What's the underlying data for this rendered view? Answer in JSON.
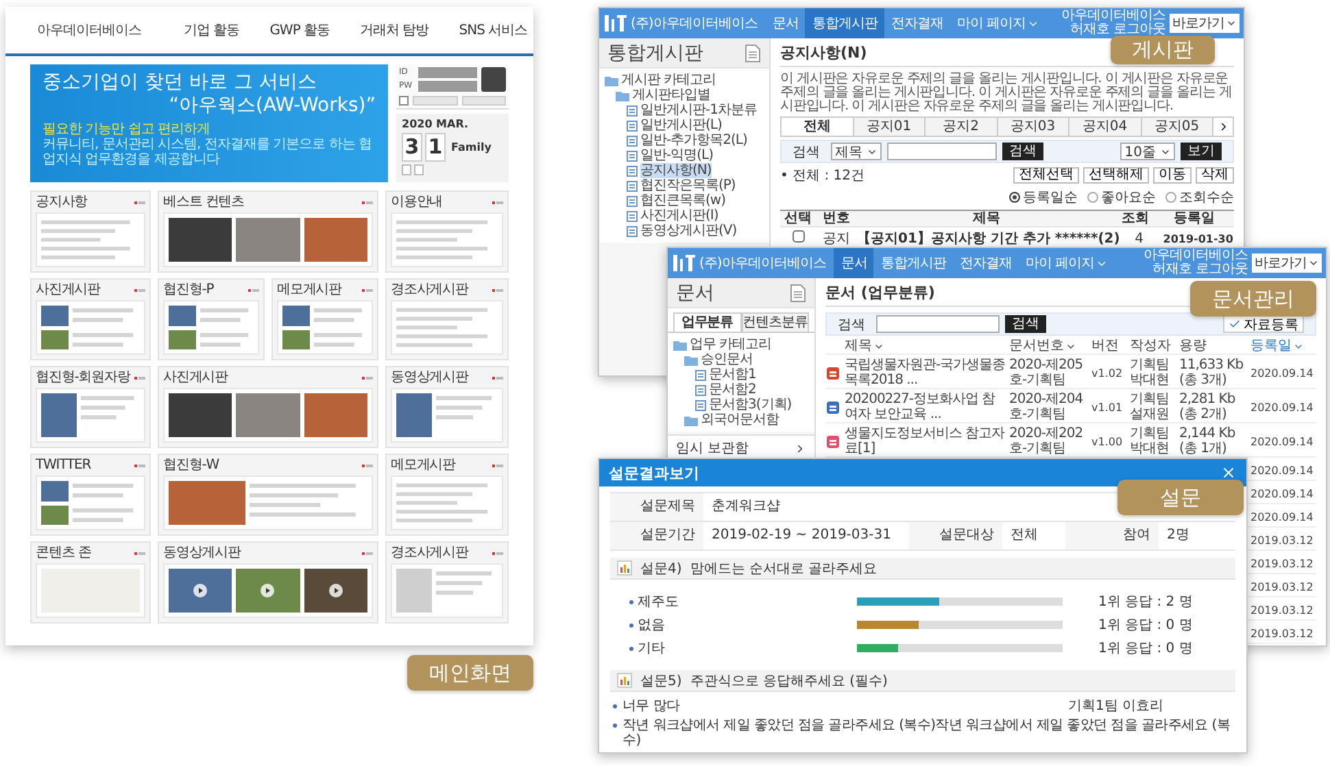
{
  "main_page": {
    "logo": "아우데이터베이스",
    "nav": [
      "기업 활동",
      "GWP 활동",
      "거래처 탐방",
      "SNS 서비스"
    ],
    "banner": {
      "title": "중소기업이 찾던 바로 그 서비스",
      "subtitle": "“아우웍스(AW-Works)”",
      "tagline": "필요한 기능만 쉽고 편리하게",
      "description": "커뮤니티, 문서관리 시스템, 전자결재를 기본으로 하는 협업지식 업무환경을 제공합니다"
    },
    "login": {
      "id_label": "ID",
      "pw_label": "PW",
      "remember_checked": false
    },
    "calendar": {
      "month": "2020 MAR.",
      "digits": [
        "3",
        "1"
      ],
      "label": "Family"
    },
    "panel_rows": [
      [
        {
          "title": "공지사항",
          "kind": "list"
        },
        {
          "title": "베스트 컨텐츠",
          "kind": "photos"
        },
        {
          "title": "이용안내",
          "kind": "list"
        }
      ],
      [
        {
          "title": "사진게시판",
          "kind": "thumbs"
        },
        {
          "title": "협진형-P",
          "kind": "thumbs"
        },
        {
          "title": "메모게시판",
          "kind": "thumbs"
        },
        {
          "title": "경조사게시판",
          "kind": "list"
        }
      ],
      [
        {
          "title": "협진형-회원자랑",
          "kind": "thumb"
        },
        {
          "title": "사진게시판",
          "kind": "photos"
        },
        {
          "title": "동영상게시판",
          "kind": "thumb"
        }
      ],
      [
        {
          "title": "TWITTER",
          "kind": "thumbs"
        },
        {
          "title": "협진형-W",
          "kind": "feature"
        },
        {
          "title": "메모게시판",
          "kind": "list"
        }
      ],
      [
        {
          "title": "콘텐츠 존",
          "kind": "promo"
        },
        {
          "title": "동영상게시판",
          "kind": "videos"
        },
        {
          "title": "경조사게시판",
          "kind": "profile"
        }
      ]
    ],
    "badge": "메인화면"
  },
  "board_window": {
    "header": {
      "logo": "(주)아우데이터베이스",
      "nav": [
        {
          "label": "문서",
          "selected": false,
          "has_menu": false
        },
        {
          "label": "통합게시판",
          "selected": true,
          "has_menu": false
        },
        {
          "label": "전자결재",
          "selected": false,
          "has_menu": false
        },
        {
          "label": "마이 페이지",
          "selected": false,
          "has_menu": true
        }
      ],
      "company": "아우데이터베이스",
      "user": "허재호",
      "logout": "로그아웃",
      "quick_select": "바로가기"
    },
    "sidebar_title": "통합게시판",
    "tree": [
      {
        "label": "게시판 카테고리",
        "kind": "folder",
        "selected": false,
        "children": [
          {
            "label": "게시판타입별",
            "kind": "folder",
            "selected": false,
            "children": [
              {
                "label": "일반게시판-1차분류",
                "kind": "page",
                "selected": false
              },
              {
                "label": "일반게시판(L)",
                "kind": "page",
                "selected": false
              },
              {
                "label": "일반-추가항목2(L)",
                "kind": "page",
                "selected": false
              },
              {
                "label": "일반-익명(L)",
                "kind": "page",
                "selected": false
              },
              {
                "label": "공지사항(N)",
                "kind": "page",
                "selected": true
              },
              {
                "label": "협진작은목록(P)",
                "kind": "page",
                "selected": false
              },
              {
                "label": "협진큰목록(w)",
                "kind": "page",
                "selected": false
              },
              {
                "label": "사진게시판(I)",
                "kind": "page",
                "selected": false
              },
              {
                "label": "동영상게시판(V)",
                "kind": "page",
                "selected": false
              }
            ]
          }
        ]
      }
    ],
    "board_title": "공지사항(N)",
    "description": "이 게시판은 자유로운 주제의 글을 올리는 게시판입니다. 이 게시판은 자유로운 주제의 글을 올리는 게시판입니다. 이 게시판은 자유로운 주제의 글을 올리는 게시판입니다. 이 게시판은 자유로운 주제의 글을 올리는 게시판입니다.",
    "tabs": [
      {
        "label": "전체",
        "selected": true
      },
      {
        "label": "공지01",
        "selected": false
      },
      {
        "label": "공지2",
        "selected": false
      },
      {
        "label": "공지03",
        "selected": false
      },
      {
        "label": "공지04",
        "selected": false
      },
      {
        "label": "공지05",
        "selected": false
      }
    ],
    "search": {
      "label": "검색",
      "field_select": "제목",
      "button": "검색",
      "rows_select": "10줄",
      "view_button": "보기"
    },
    "total": "• 전체 : 12건",
    "actions": [
      "전체선택",
      "선택해제",
      "이동",
      "삭제"
    ],
    "sort_options": [
      {
        "label": "등록일순",
        "selected": true
      },
      {
        "label": "좋아요순",
        "selected": false
      },
      {
        "label": "조회수순",
        "selected": false
      }
    ],
    "columns": [
      "선택",
      "번호",
      "제목",
      "조회",
      "등록일"
    ],
    "rows": [
      {
        "checked": false,
        "number": "공지",
        "title": "【공지01】공지사항 기간 추가 ******(2)",
        "views": "4",
        "date": "2019-01-30"
      }
    ],
    "badge": "게시판"
  },
  "document_window": {
    "header": {
      "logo": "(주)아우데이터베이스",
      "nav": [
        {
          "label": "문서",
          "selected": true,
          "has_menu": false
        },
        {
          "label": "통합게시판",
          "selected": false,
          "has_menu": false
        },
        {
          "label": "전자결재",
          "selected": false,
          "has_menu": false
        },
        {
          "label": "마이 페이지",
          "selected": false,
          "has_menu": true
        }
      ],
      "company": "아우데이터베이스",
      "user": "허재호",
      "logout": "로그아웃",
      "quick_select": "바로가기"
    },
    "sidebar_title": "문서",
    "tabs": [
      {
        "label": "업무분류",
        "selected": true
      },
      {
        "label": "컨텐츠분류",
        "selected": false
      }
    ],
    "tree": [
      {
        "label": "업무 카테고리",
        "kind": "folder",
        "selected": false,
        "children": [
          {
            "label": "승인문서",
            "kind": "folder",
            "selected": false,
            "children": [
              {
                "label": "문서함1",
                "kind": "page",
                "selected": false
              },
              {
                "label": "문서함2",
                "kind": "page",
                "selected": false
              },
              {
                "label": "문서함3(기획)",
                "kind": "page",
                "selected": false
              }
            ]
          },
          {
            "label": "외국어문서함",
            "kind": "folder",
            "selected": false
          }
        ]
      }
    ],
    "temp_box": "임시 보관함",
    "title": "문서 (업무분류)",
    "search": {
      "label": "검색",
      "button": "검색"
    },
    "register_button": "자료등록",
    "columns": [
      {
        "label": "제목",
        "sort_icon": true,
        "selected": false
      },
      {
        "label": "문서번호",
        "sort_icon": true,
        "selected": false
      },
      {
        "label": "버전",
        "sort_icon": false,
        "selected": false
      },
      {
        "label": "작성자",
        "sort_icon": false,
        "selected": false
      },
      {
        "label": "용량",
        "sort_icon": false,
        "selected": false
      },
      {
        "label": "등록일",
        "sort_icon": true,
        "selected": true
      }
    ],
    "rows": [
      {
        "color": "#d9452f",
        "title": "국립생물자원관-국가생물종목록2018 ...",
        "number": "2020-제205호-기획팀",
        "version": "v1.02",
        "author": "기획팀 박대현",
        "size": "11,633 Kb (총 3개)",
        "date": "2020.09.14"
      },
      {
        "color": "#3a6fc4",
        "title": "20200227-정보화사업 참여자 보안교육 ...",
        "number": "2020-제204호-기획팀",
        "version": "v1.01",
        "author": "기획팀 설재원",
        "size": "2,281 Kb (총 2개)",
        "date": "2020.09.14"
      },
      {
        "color": "#e0506a",
        "title": "생물지도정보서비스 참고자료[1]",
        "number": "2020-제202호-기획팀",
        "version": "v1.00",
        "author": "기획팀 박대현",
        "size": "2,144 Kb (총 1개)",
        "date": "2020.09.14"
      },
      {
        "date": "2020.09.14"
      },
      {
        "date": "2020.09.14"
      },
      {
        "date": "2020.09.14"
      },
      {
        "date": "2019.03.12"
      },
      {
        "date": "2019.03.12"
      },
      {
        "date": "2019.03.12"
      },
      {
        "date": "2019.03.12"
      },
      {
        "date": "2019.03.12"
      }
    ],
    "badge": "문서관리"
  },
  "survey_popup": {
    "title": "설문결과보기",
    "info": {
      "title_label": "설문제목",
      "title_value": "춘계워크샵",
      "period_label": "설문기간",
      "period_value": "2019-02-19 ~ 2019-03-31",
      "target_label": "설문대상",
      "target_value": "전체",
      "participants_label": "참여",
      "participants_value": "2명"
    },
    "questions": [
      {
        "kind": "choice",
        "number": "설문4)",
        "text": "맘에드는 순서대로 골라주세요",
        "options": [
          {
            "label": "제주도",
            "level": 0.4,
            "color": "#2a9fb8",
            "result": "1위 응답 : 2 명"
          },
          {
            "label": "없음",
            "level": 0.3,
            "color": "#b8892c",
            "result": "1위 응답 : 0 명"
          },
          {
            "label": "기타",
            "level": 0.2,
            "color": "#2fae62",
            "result": "1위 응답 : 0 명"
          }
        ]
      },
      {
        "kind": "text",
        "number": "설문5)",
        "text": "주관식으로 응답해주세요 (필수)",
        "answers": [
          {
            "text": "너무 많다",
            "respondent": "기획1팀 이효리"
          },
          {
            "text": "작년 워크샵에서 제일 좋았던 점을 골라주세요 (복수)작년 워크샵에서 제일 좋았던 점을 골라주세요 (복수)"
          }
        ]
      }
    ],
    "badge": "설문"
  }
}
